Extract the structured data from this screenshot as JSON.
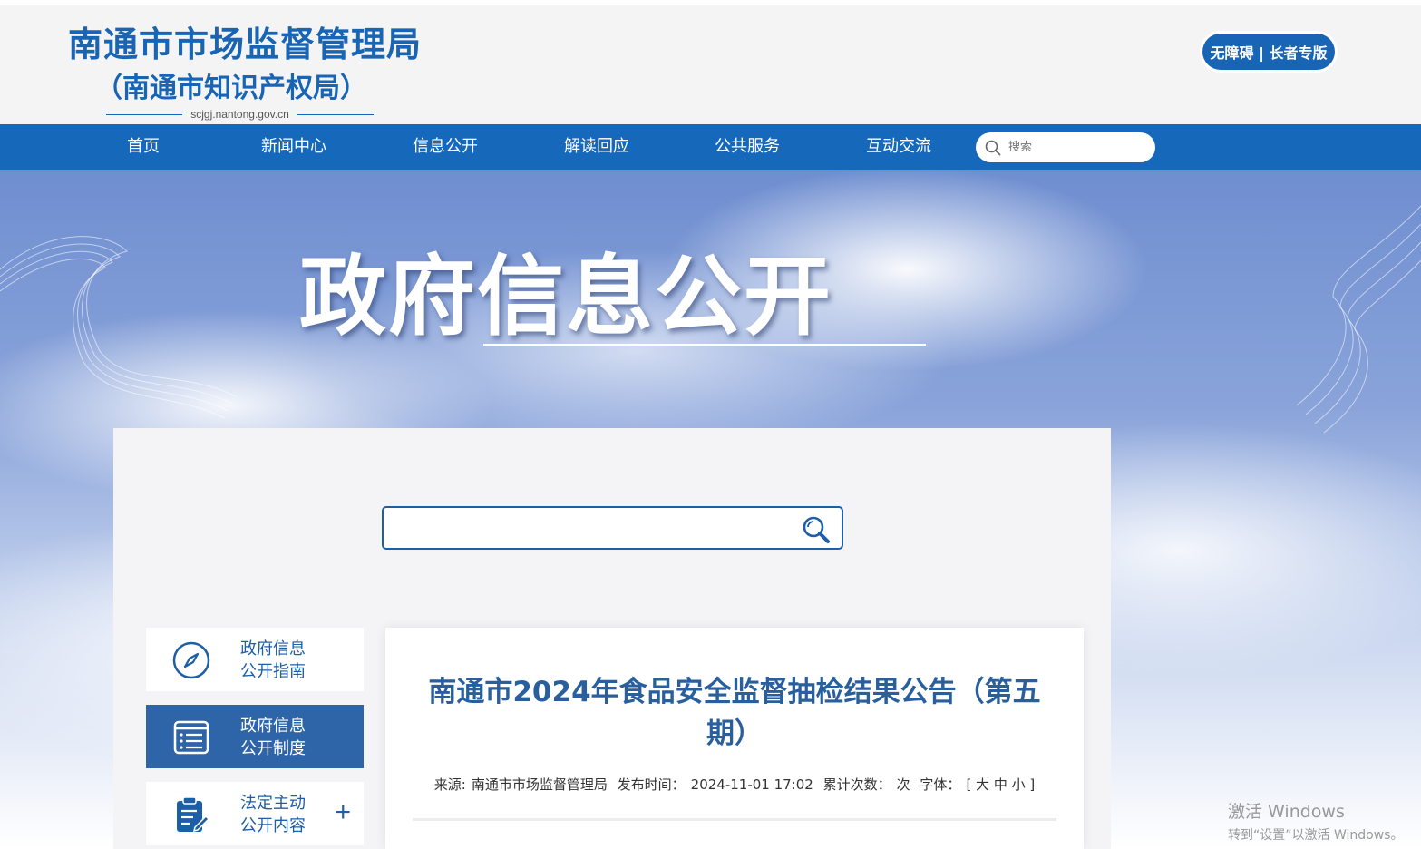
{
  "header": {
    "site_title": "南通市市场监督管理局",
    "site_subtitle": "（南通市知识产权局）",
    "site_url": "scjgj.nantong.gov.cn",
    "accessibility_button": "无障碍 | 长者专版"
  },
  "nav": {
    "items": [
      {
        "label": "首页"
      },
      {
        "label": "新闻中心"
      },
      {
        "label": "信息公开"
      },
      {
        "label": "解读回应"
      },
      {
        "label": "公共服务"
      },
      {
        "label": "互动交流"
      }
    ],
    "search_placeholder": "搜索"
  },
  "banner": {
    "title": "政府信息公开"
  },
  "panel": {
    "search_placeholder": "",
    "sidebar": [
      {
        "line1": "政府信息",
        "line2": "公开指南",
        "icon": "compass-icon",
        "active": false
      },
      {
        "line1": "政府信息",
        "line2": "公开制度",
        "icon": "document-list-icon",
        "active": true
      },
      {
        "line1": "法定主动",
        "line2": "公开内容",
        "icon": "clipboard-edit-icon",
        "active": false,
        "expand": "+"
      }
    ],
    "article": {
      "title": "南通市2024年食品安全监督抽检结果公告（第五期）",
      "source_label": "来源:",
      "source": "南通市市场监督管理局",
      "publish_label": "发布时间：",
      "publish_time": "2024-11-01 17:02",
      "views_label": "累计次数：",
      "views_unit": "次",
      "font_label": "字体：",
      "font_sizes": "[ 大 中 小 ]"
    }
  },
  "watermark": {
    "line1": "激活 Windows",
    "line2": "转到“设置”以激活 Windows。"
  },
  "colors": {
    "brand_blue": "#1865b5",
    "nav_blue": "#1668bb",
    "sidebar_active": "#2e64a8",
    "title_blue": "#2a5f9e"
  }
}
